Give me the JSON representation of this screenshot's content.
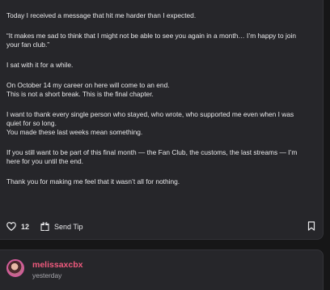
{
  "post": {
    "paragraphs": [
      [
        "Today I received a message that hit me harder than I expected."
      ],
      [
        "“It makes me sad to think that I might not be able to see you again in a month… I’m happy to join",
        "your fan club.”"
      ],
      [
        "I sat with it for a while."
      ],
      [
        "On October 14 my career on here will come to an end.",
        "This is not a short break. This is the final chapter."
      ],
      [
        "I want to thank every single person who stayed, who wrote, who supported me even when I was",
        "quiet for so long.",
        "You made these last weeks mean something."
      ],
      [
        "If you still want to be part of this final month — the Fan Club, the customs, the last streams — I’m",
        "here for you until the end."
      ],
      [
        "Thank you for making me feel that it wasn’t all for nothing."
      ]
    ],
    "actions": {
      "like_icon": "heart-icon",
      "like_count": "12",
      "tip_icon": "gift-icon",
      "tip_label": "Send Tip",
      "bookmark_icon": "bookmark-icon"
    }
  },
  "comment": {
    "username": "melissaxcbx",
    "timestamp": "yesterday",
    "accent_color": "#f05a7e"
  }
}
